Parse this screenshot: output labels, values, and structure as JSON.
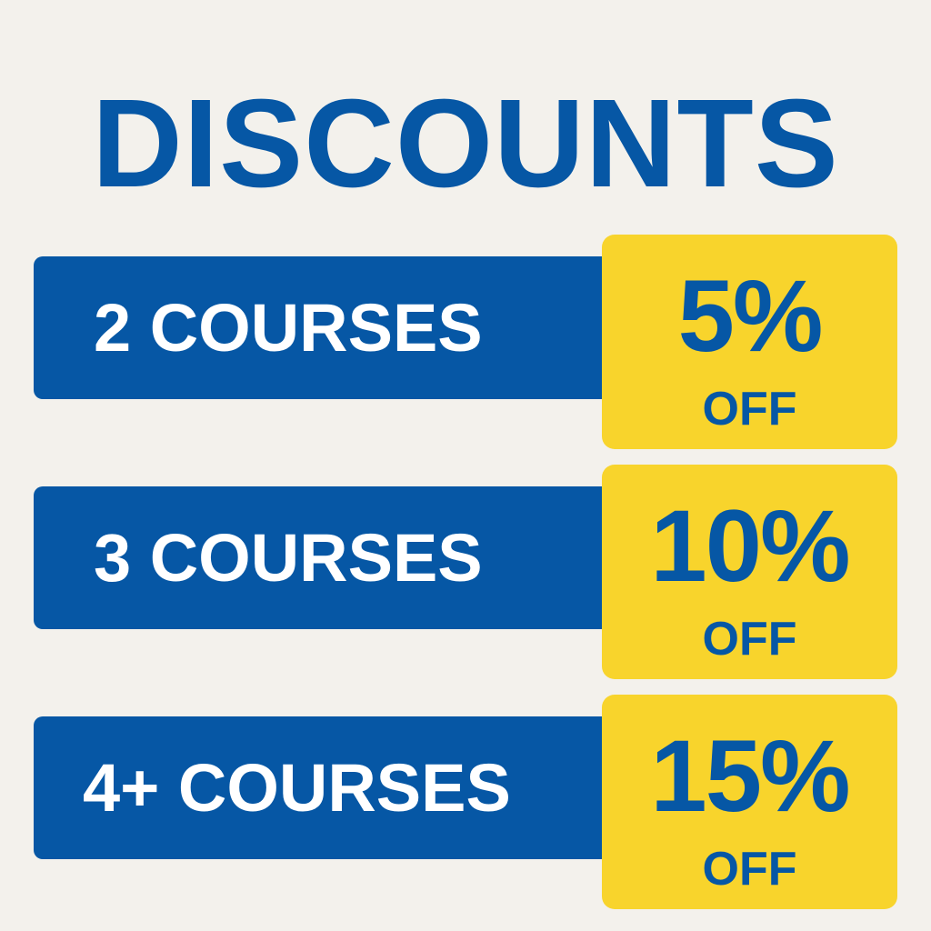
{
  "title": "DISCOUNTS",
  "colors": {
    "background": "#f3f1ec",
    "primary_blue": "#0657a5",
    "accent_yellow": "#f8d42c",
    "label_text": "#ffffff"
  },
  "tiers": [
    {
      "label": "2 COURSES",
      "percent": "5%",
      "off": "OFF"
    },
    {
      "label": "3 COURSES",
      "percent": "10%",
      "off": "OFF"
    },
    {
      "label": "4+ COURSES",
      "percent": "15%",
      "off": "OFF"
    }
  ]
}
